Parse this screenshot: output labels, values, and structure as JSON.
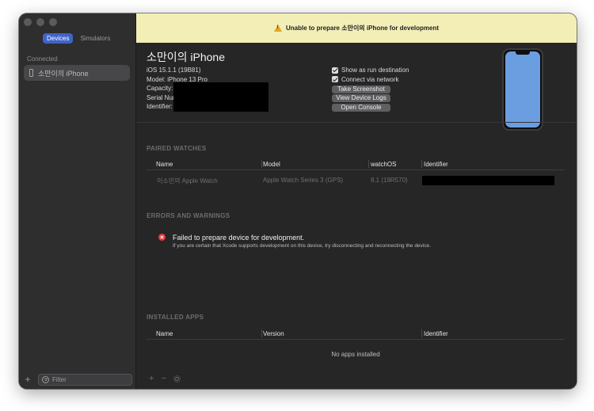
{
  "sidebar": {
    "tabs": [
      {
        "label": "Devices",
        "active": true
      },
      {
        "label": "Simulators",
        "active": false
      }
    ],
    "section_label": "Connected",
    "device_name": "소만이의 iPhone",
    "filter_placeholder": "Filter",
    "add_icon": "plus-icon"
  },
  "banner": {
    "text": "Unable to prepare 소만이의 iPhone for development",
    "color": "#f3eeb6"
  },
  "device": {
    "name": "소만이의 iPhone",
    "ios": "iOS 15.1.1 (19B81)",
    "model": "Model: iPhone 13 Pro",
    "capacity_label": "Capacity:",
    "serial_label": "Serial Nur",
    "identifier_label": "Identifier:"
  },
  "options": {
    "run_destination": "Show as run destination",
    "connect_network": "Connect via network",
    "take_screenshot": "Take Screenshot",
    "view_logs": "View Device Logs",
    "open_console": "Open Console"
  },
  "paired_watches": {
    "title": "PAIRED WATCHES",
    "columns": [
      "Name",
      "Model",
      "watchOS",
      "Identifier"
    ],
    "rows": [
      {
        "name": "이소민의 Apple Watch",
        "model": "Apple Watch Series 3 (GPS)",
        "os": "8.1 (19R570)"
      }
    ]
  },
  "errors": {
    "title": "ERRORS AND WARNINGS",
    "message": "Failed to prepare device for development.",
    "detail": "If you are certain that Xcode supports development on this device, try disconnecting and reconnecting the device."
  },
  "installed_apps": {
    "title": "INSTALLED APPS",
    "columns": [
      "Name",
      "Version",
      "Identifier"
    ],
    "empty": "No apps installed"
  },
  "colors": {
    "accent": "#3f64c9",
    "error": "#e8393e",
    "warning": "#e1a526",
    "phone_screen": "#6b9ee0"
  }
}
